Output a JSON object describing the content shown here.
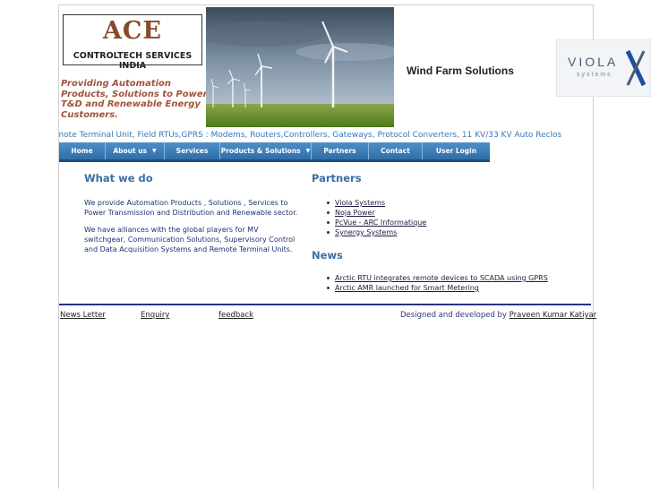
{
  "header": {
    "logo_name": "ACE",
    "logo_sub": "CONTROLTECH SERVICES INDIA",
    "tagline": "Providing Automation Products, Solutions to Power T&D and Renewable Energy Customers.",
    "banner_title": "Wind Farm Solutions",
    "partner_logo_name": "VIOLA",
    "partner_logo_sub": "systems"
  },
  "marquee": "ADA Solutions, Remote Terminal Unit, Field RTUs,GPRS : Modems, Routers,Controllers, Gateways, Protocol Converters, 11 KV/33 KV Auto Reclos",
  "nav": {
    "items": [
      {
        "label": "Home",
        "dropdown": false
      },
      {
        "label": "About us",
        "dropdown": true
      },
      {
        "label": "Services",
        "dropdown": false
      },
      {
        "label": "Products & Solutions",
        "dropdown": true
      },
      {
        "label": "Partners",
        "dropdown": false
      },
      {
        "label": "Contact",
        "dropdown": false
      },
      {
        "label": "User Login",
        "dropdown": false
      }
    ]
  },
  "what_we_do": {
    "title": "What we do",
    "para1_line1": "We provide Automation Products , Solutions , Services to",
    "para1_line2": "Power Transmission and Distribution and Renewable sector.",
    "para2_line1": "We have alliances with the global players for MV",
    "para2_line2": "switchgear, Communication Solutions, Supervisory Control",
    "para2_line3": "and Data Acquisition Systems and Remote Terminal Units."
  },
  "partners": {
    "title": "Partners",
    "items": [
      "Viola Systems",
      "Noja Power",
      "PcVue - ARC Informatique",
      "Synergy Systems"
    ]
  },
  "news": {
    "title": "News",
    "items": [
      "Arctic RTU integrates remote devices to SCADA using GPRS",
      "Arctic AMR launched for Smart Metering"
    ]
  },
  "footer": {
    "news_letter": "News Letter",
    "enquiry": "Enquiry",
    "feedback": "feedback",
    "credit_prefix": "Designed and developed by",
    "credit_name": "Praveen Kumar Katiyar"
  },
  "colors": {
    "nav": "#3f7fbb",
    "heading": "#3a6ea5",
    "tagline": "#a2533a",
    "divider": "#28328a"
  }
}
